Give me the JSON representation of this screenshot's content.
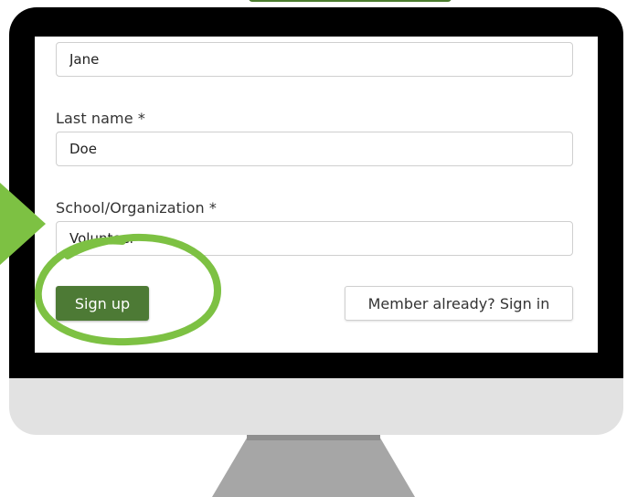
{
  "form": {
    "first_name_value": "Jane",
    "last_name_label": "Last name *",
    "last_name_value": "Doe",
    "org_label": "School/Organization *",
    "org_value": "Volunteer"
  },
  "buttons": {
    "sign_up": "Sign up",
    "sign_in": "Member already? Sign in"
  },
  "colors": {
    "primary_button": "#4d7a35",
    "highlight": "#7dc143"
  },
  "icons": {
    "pointer": "pointer-arrow-icon"
  }
}
